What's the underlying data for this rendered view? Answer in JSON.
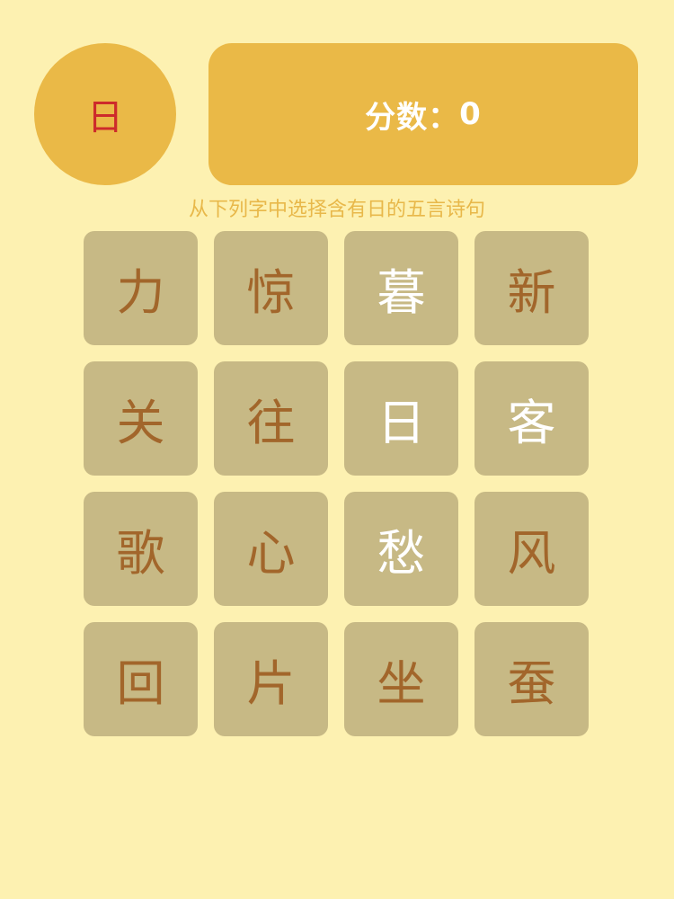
{
  "key_char": "日",
  "score": {
    "label": "分数：",
    "value": "0"
  },
  "instruction": "从下列字中选择含有日的五言诗句",
  "colors": {
    "background": "#fdf1b1",
    "panel": "#eab947",
    "tile": "#c7b985",
    "key_char": "#cd2b2b",
    "char_default": "#a2662b",
    "char_highlight": "#ffffff"
  },
  "tiles": [
    {
      "char": "力",
      "highlighted": false
    },
    {
      "char": "惊",
      "highlighted": false
    },
    {
      "char": "暮",
      "highlighted": true
    },
    {
      "char": "新",
      "highlighted": false
    },
    {
      "char": "关",
      "highlighted": false
    },
    {
      "char": "往",
      "highlighted": false
    },
    {
      "char": "日",
      "highlighted": true
    },
    {
      "char": "客",
      "highlighted": true
    },
    {
      "char": "歌",
      "highlighted": false
    },
    {
      "char": "心",
      "highlighted": false
    },
    {
      "char": "愁",
      "highlighted": true
    },
    {
      "char": "风",
      "highlighted": false
    },
    {
      "char": "回",
      "highlighted": false
    },
    {
      "char": "片",
      "highlighted": false
    },
    {
      "char": "坐",
      "highlighted": false
    },
    {
      "char": "蚕",
      "highlighted": false
    }
  ]
}
